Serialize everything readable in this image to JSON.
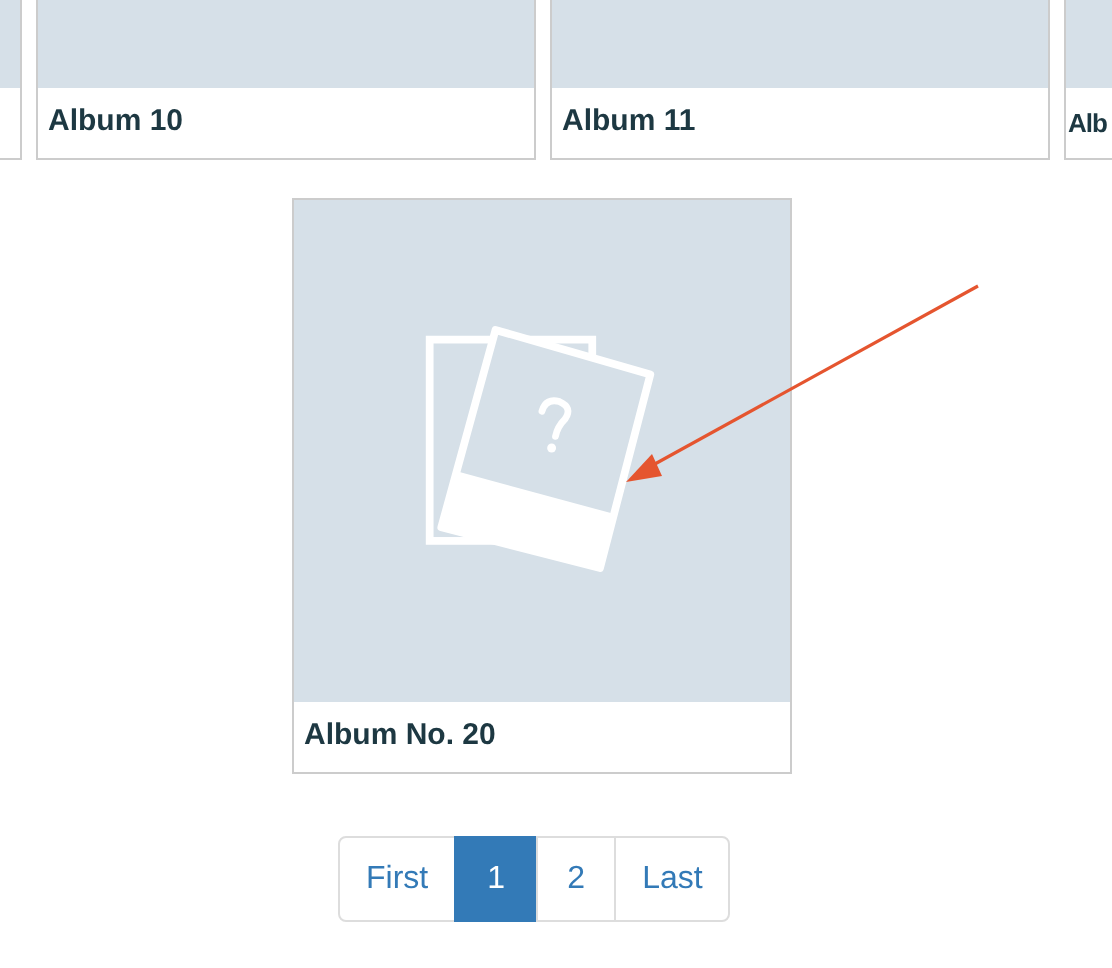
{
  "top_row": [
    {
      "kind": "edge"
    },
    {
      "kind": "card",
      "title": "Album 10"
    },
    {
      "kind": "card",
      "title": "Album 11"
    },
    {
      "kind": "cut",
      "title": "Alb"
    }
  ],
  "featured_album": {
    "title": "Album No. 20"
  },
  "pagination": [
    {
      "label": "First",
      "selected": false
    },
    {
      "label": "1",
      "selected": true
    },
    {
      "label": "2",
      "selected": false
    },
    {
      "label": "Last",
      "selected": false
    }
  ]
}
